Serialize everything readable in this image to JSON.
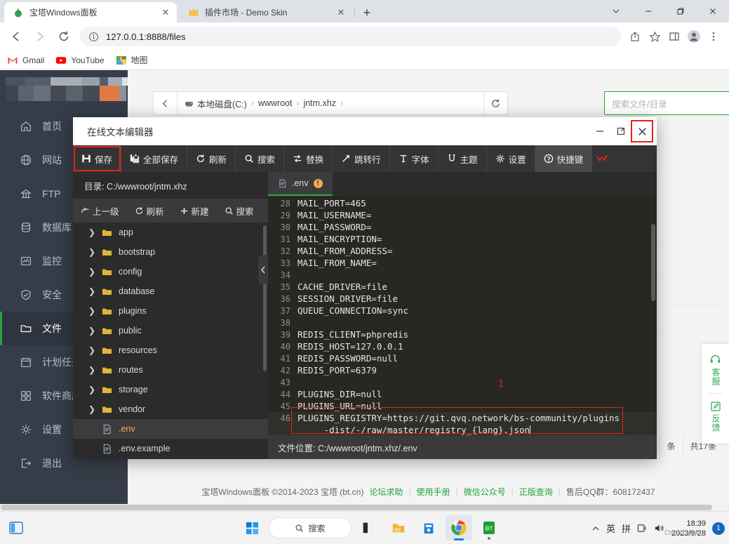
{
  "browser": {
    "tabs": [
      {
        "title": "宝塔Windows面板",
        "favicon": "bt-panel-icon",
        "active": true
      },
      {
        "title": "插件市场 - Demo Skin",
        "favicon": "crown-icon",
        "active": false
      }
    ],
    "new_tab_label": "+",
    "window_controls": [
      "chevron-down",
      "minimize",
      "restore",
      "close"
    ],
    "nav": {
      "back": "←",
      "forward": "→",
      "reload": "⟳"
    },
    "omnibox": {
      "info_icon": "info-circle-icon",
      "url": "127.0.0.1:8888/files"
    },
    "toolbar_icons": [
      "share-icon",
      "star-icon",
      "sidepanel-icon",
      "profile-icon",
      "menu-icon"
    ],
    "bookmarks": [
      {
        "label": "Gmail",
        "icon": "gmail-icon"
      },
      {
        "label": "YouTube",
        "icon": "youtube-icon"
      },
      {
        "label": "地图",
        "icon": "maps-icon"
      }
    ]
  },
  "panel": {
    "sidebar": [
      {
        "label": "首页",
        "icon": "home-icon",
        "active": false
      },
      {
        "label": "网站",
        "icon": "globe-icon",
        "active": false
      },
      {
        "label": "FTP",
        "icon": "ftp-icon",
        "active": false
      },
      {
        "label": "数据库",
        "icon": "database-icon",
        "active": false
      },
      {
        "label": "监控",
        "icon": "monitor-icon",
        "active": false
      },
      {
        "label": "安全",
        "icon": "shield-icon",
        "active": false
      },
      {
        "label": "文件",
        "icon": "folder-icon",
        "active": true
      },
      {
        "label": "计划任务",
        "icon": "calendar-icon",
        "active": false
      },
      {
        "label": "软件商店",
        "icon": "apps-icon",
        "active": false
      },
      {
        "label": "设置",
        "icon": "gear-icon",
        "active": false
      },
      {
        "label": "退出",
        "icon": "logout-icon",
        "active": false
      }
    ],
    "breadcrumb": {
      "back_icon": "arrow-left-icon",
      "items": [
        "本地磁盘(C:)",
        "wwwroot",
        "jntm.xhz"
      ],
      "separator": "›",
      "refresh_icon": "refresh-icon"
    },
    "search": {
      "placeholder": "搜索文件/目录",
      "value": ""
    },
    "pagination": {
      "per_page_suffix": "条",
      "total": "共17条"
    },
    "footer": {
      "copyright": "宝塔Windows面板 ©2014-2023 宝塔 (bt.cn)",
      "links": [
        "论坛求助",
        "使用手册",
        "微信公众号",
        "正版查询"
      ],
      "qq": "售后QQ群：608172437",
      "separator": "|"
    },
    "side_widget": [
      {
        "label": "客服",
        "icon": "headset-icon"
      },
      {
        "label": "反馈",
        "icon": "edit-icon"
      }
    ]
  },
  "editor": {
    "title": "在线文本编辑器",
    "window_controls": {
      "minimize": "—",
      "maximize": "⤢",
      "close": "✕"
    },
    "toolbar": [
      {
        "label": "保存",
        "icon": "save-icon",
        "highlighted": true
      },
      {
        "label": "全部保存",
        "icon": "save-all-icon",
        "highlighted": false
      },
      {
        "label": "刷新",
        "icon": "refresh-icon",
        "highlighted": false
      },
      {
        "label": "搜索",
        "icon": "search-icon",
        "highlighted": false
      },
      {
        "label": "替换",
        "icon": "replace-icon",
        "highlighted": false
      },
      {
        "label": "跳转行",
        "icon": "goto-line-icon",
        "highlighted": false
      },
      {
        "label": "字体",
        "icon": "font-icon",
        "highlighted": false
      },
      {
        "label": "主题",
        "icon": "theme-icon",
        "highlighted": false
      },
      {
        "label": "设置",
        "icon": "gear-icon",
        "highlighted": false
      },
      {
        "label": "快捷键",
        "icon": "help-icon",
        "highlighted": false
      }
    ],
    "toolbar_more_icon": "chevron-down-icon",
    "directory_label": "目录: C:/wwwroot/jntm.xhz",
    "file_toolbar": [
      {
        "label": "上一级",
        "icon": "level-up-icon"
      },
      {
        "label": "刷新",
        "icon": "refresh-icon"
      },
      {
        "label": "新建",
        "icon": "plus-icon"
      },
      {
        "label": "搜索",
        "icon": "search-icon"
      }
    ],
    "file_tree": [
      {
        "name": "app",
        "type": "folder",
        "selected": false
      },
      {
        "name": "bootstrap",
        "type": "folder",
        "selected": false
      },
      {
        "name": "config",
        "type": "folder",
        "selected": false
      },
      {
        "name": "database",
        "type": "folder",
        "selected": false
      },
      {
        "name": "plugins",
        "type": "folder",
        "selected": false
      },
      {
        "name": "public",
        "type": "folder",
        "selected": false
      },
      {
        "name": "resources",
        "type": "folder",
        "selected": false
      },
      {
        "name": "routes",
        "type": "folder",
        "selected": false
      },
      {
        "name": "storage",
        "type": "folder",
        "selected": false
      },
      {
        "name": "vendor",
        "type": "folder",
        "selected": false
      },
      {
        "name": ".env",
        "type": "file",
        "selected": true
      },
      {
        "name": ".env.example",
        "type": "file",
        "selected": false
      }
    ],
    "collapse_handle_icon": "chevron-left-icon",
    "tab": {
      "name": ".env",
      "icon": "file-icon",
      "warning": "!"
    },
    "code_lines": [
      {
        "num": "28",
        "text": "MAIL_PORT=465"
      },
      {
        "num": "29",
        "text": "MAIL_USERNAME="
      },
      {
        "num": "30",
        "text": "MAIL_PASSWORD="
      },
      {
        "num": "31",
        "text": "MAIL_ENCRYPTION="
      },
      {
        "num": "32",
        "text": "MAIL_FROM_ADDRESS="
      },
      {
        "num": "33",
        "text": "MAIL_FROM_NAME="
      },
      {
        "num": "34",
        "text": ""
      },
      {
        "num": "35",
        "text": "CACHE_DRIVER=file"
      },
      {
        "num": "36",
        "text": "SESSION_DRIVER=file"
      },
      {
        "num": "37",
        "text": "QUEUE_CONNECTION=sync"
      },
      {
        "num": "38",
        "text": ""
      },
      {
        "num": "39",
        "text": "REDIS_CLIENT=phpredis"
      },
      {
        "num": "40",
        "text": "REDIS_HOST=127.0.0.1"
      },
      {
        "num": "41",
        "text": "REDIS_PASSWORD=null"
      },
      {
        "num": "42",
        "text": "REDIS_PORT=6379"
      },
      {
        "num": "43",
        "text": ""
      },
      {
        "num": "44",
        "text": "PLUGINS_DIR=null"
      },
      {
        "num": "45",
        "text": "PLUGINS_URL=null"
      },
      {
        "num": "46",
        "text": "PLUGINS_REGISTRY=https://git.qvq.network/bs-community/plugins"
      },
      {
        "num": "",
        "text": "     -dist/-/raw/master/registry_{lang}.json"
      }
    ],
    "annotation": "1",
    "status": "文件位置: C:/wwwroot/jntm.xhz/.env"
  },
  "taskbar": {
    "start_icon": "windows-start-icon",
    "search_label": "搜索",
    "apps": [
      "file-explorer-dark-icon",
      "folder-icon",
      "store-icon",
      "chrome-icon",
      "bt-icon"
    ],
    "tray": [
      "chevron-up-icon",
      "英",
      "拼",
      "keyboard-icon",
      "volume-icon"
    ],
    "clock": {
      "time": "18:39",
      "date": "2023/9/28"
    },
    "watermark": "ChinaZ.com",
    "notification_count": "1"
  },
  "colors": {
    "accent_green": "#20a53a",
    "red_highlight": "#e2231a",
    "sidebar_bg": "#363d48",
    "editor_bg": "#272822",
    "warn_orange": "#f0ad4e"
  }
}
